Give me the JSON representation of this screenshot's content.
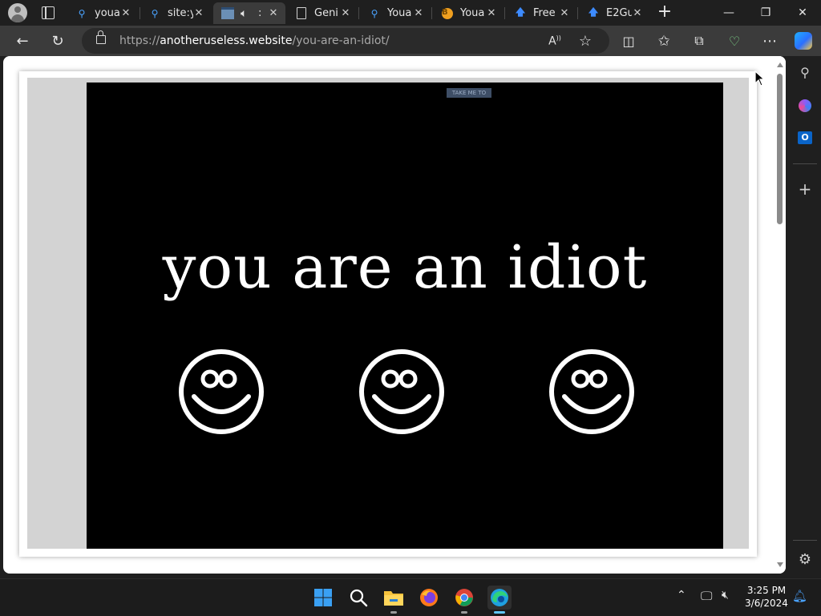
{
  "tabs": [
    {
      "title": "youa",
      "favicon": "search-icon",
      "active": false
    },
    {
      "title": "site:y",
      "favicon": "search-icon",
      "active": false
    },
    {
      "title": ":",
      "favicon": "window-icon",
      "active": true,
      "audio": true
    },
    {
      "title": "Geni",
      "favicon": "document-icon",
      "active": false
    },
    {
      "title": "Youa",
      "favicon": "search-icon",
      "active": false
    },
    {
      "title": "Youa",
      "favicon": "coin-icon",
      "active": false
    },
    {
      "title": "Free",
      "favicon": "arrow-up-icon",
      "active": false
    },
    {
      "title": "E2Gu",
      "favicon": "arrow-up-icon",
      "active": false
    }
  ],
  "address": {
    "scheme": "https://",
    "host": "anotheruseless.website",
    "path": "/you-are-an-idiot/"
  },
  "page": {
    "take_me_to": "TAKE ME TO",
    "headline": "you are an idiot",
    "smiley_count": 3
  },
  "taskbar": {
    "time": "3:25 PM",
    "date": "3/6/2024"
  },
  "colors": {
    "stage_background": "#000000",
    "text": "#ffffff",
    "frame_gray": "#d3d3d3",
    "accent": "#0078d4"
  }
}
